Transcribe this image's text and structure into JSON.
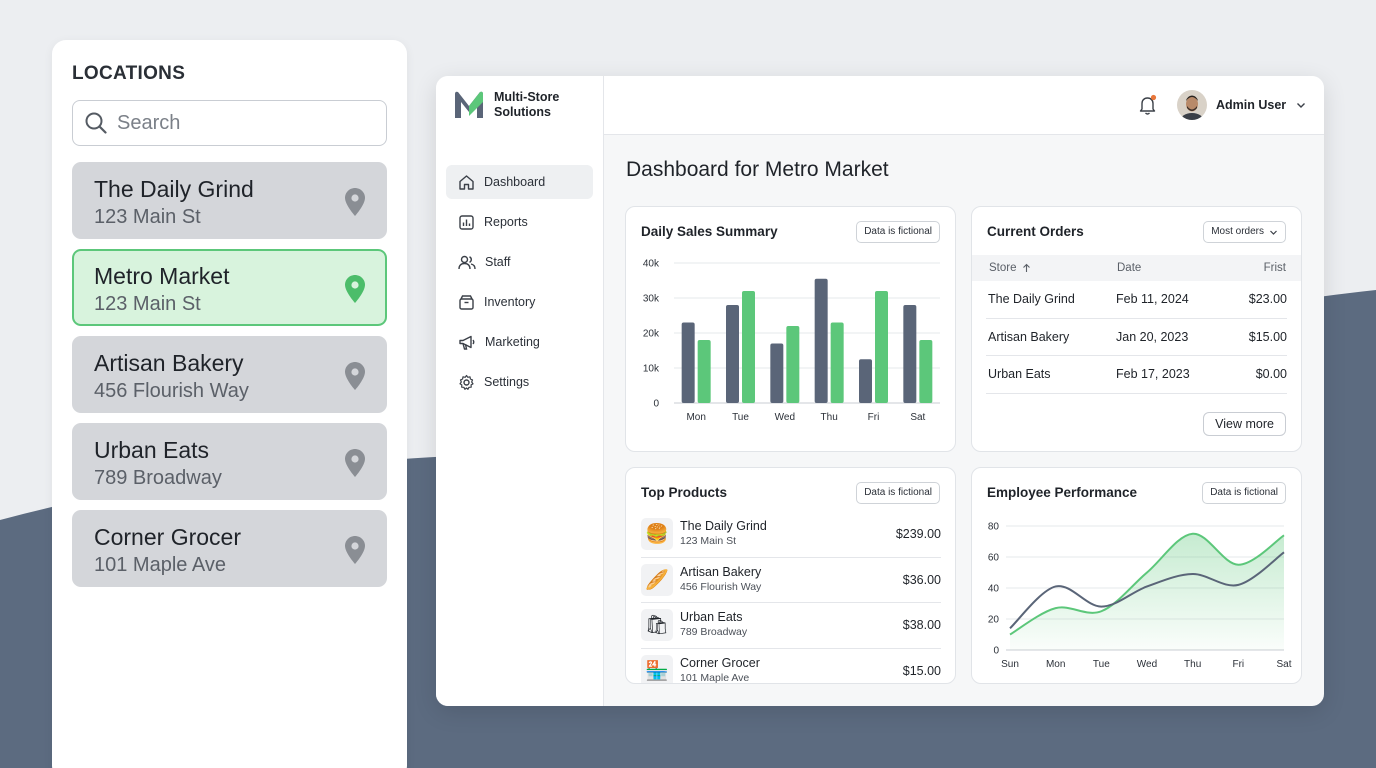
{
  "locations": {
    "title": "LOCATIONS",
    "search_placeholder": "Search",
    "items": [
      {
        "name": "The Daily Grind",
        "address": "123 Main St",
        "active": false
      },
      {
        "name": "Metro Market",
        "address": "123 Main St",
        "active": true
      },
      {
        "name": "Artisan Bakery",
        "address": "456 Flourish Way",
        "active": false
      },
      {
        "name": "Urban Eats",
        "address": "789 Broadway",
        "active": false
      },
      {
        "name": "Corner Grocer",
        "address": "101 Maple Ave",
        "active": false
      }
    ]
  },
  "brand": {
    "name": "Multi-Store Solutions"
  },
  "nav": [
    {
      "label": "Dashboard",
      "icon": "home-icon"
    },
    {
      "label": "Reports",
      "icon": "report-icon"
    },
    {
      "label": "Staff",
      "icon": "users-icon"
    },
    {
      "label": "Inventory",
      "icon": "box-icon"
    },
    {
      "label": "Marketing",
      "icon": "megaphone-icon"
    },
    {
      "label": "Settings",
      "icon": "gear-icon"
    }
  ],
  "user": {
    "name": "Admin User"
  },
  "page": {
    "title": "Dashboard for Metro Market"
  },
  "sales_card": {
    "title": "Daily Sales Summary",
    "badge": "Data is fictional"
  },
  "orders_card": {
    "title": "Current Orders",
    "sort_label": "Most orders",
    "columns": [
      "Store",
      "Date",
      "Frist"
    ],
    "rows": [
      {
        "store": "The Daily Grind",
        "date": "Feb 11, 2024",
        "amount": "$23.00"
      },
      {
        "store": "Artisan Bakery",
        "date": "Jan 20, 2023",
        "amount": "$15.00"
      },
      {
        "store": "Urban Eats",
        "date": "Feb 17, 2023",
        "amount": "$0.00"
      }
    ],
    "view_more": "View more"
  },
  "products_card": {
    "title": "Top Products",
    "badge": "Data is fictional",
    "items": [
      {
        "name": "The Daily Grind",
        "address": "123 Main St",
        "price": "$239.00",
        "emoji": "🍔"
      },
      {
        "name": "Artisan Bakery",
        "address": "456 Flourish Way",
        "price": "$36.00",
        "emoji": "🥖"
      },
      {
        "name": "Urban Eats",
        "address": "789 Broadway",
        "price": "$38.00",
        "emoji": "🛍"
      },
      {
        "name": "Corner Grocer",
        "address": "101 Maple Ave",
        "price": "$15.00",
        "emoji": "🏪"
      }
    ]
  },
  "perf_card": {
    "title": "Employee Performance",
    "badge": "Data is fictional"
  },
  "colors": {
    "green": "#5cc77a",
    "slate": "#5a6578",
    "bg_wave": "#5c6b80"
  },
  "chart_data": [
    {
      "type": "bar",
      "categories": [
        "Mon",
        "Tue",
        "Wed",
        "Thu",
        "Fri",
        "Sat"
      ],
      "series": [
        {
          "values": [
            23000,
            28000,
            17000,
            35500,
            12500,
            28000
          ],
          "color": "#5a6578"
        },
        {
          "values": [
            18000,
            32000,
            22000,
            23000,
            32000,
            18000
          ],
          "color": "#5cc77a"
        }
      ],
      "yticks": [
        "0",
        "10k",
        "20k",
        "30k",
        "40k"
      ],
      "ylim": [
        0,
        40000
      ],
      "grid": true
    },
    {
      "type": "line",
      "categories": [
        "Sun",
        "Mon",
        "Tue",
        "Wed",
        "Thu",
        "Fri",
        "Sat"
      ],
      "series": [
        {
          "values": [
            10,
            27,
            25,
            50,
            75,
            55,
            74
          ],
          "color": "#5cc77a",
          "fill": true
        },
        {
          "values": [
            14,
            41,
            28,
            41,
            49,
            42,
            63
          ],
          "color": "#5a6578",
          "fill": false
        }
      ],
      "yticks": [
        "0",
        "20",
        "40",
        "60",
        "80"
      ],
      "ylim": [
        0,
        80
      ],
      "grid": true
    }
  ]
}
